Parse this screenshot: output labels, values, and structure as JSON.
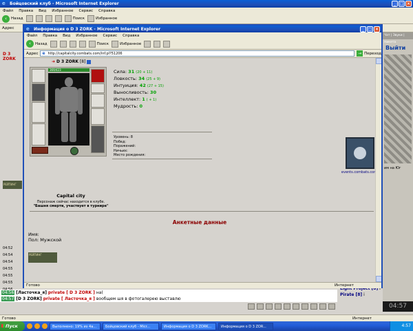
{
  "bg_window": {
    "title": "Бойцовский клуб - Microsoft Internet Explorer",
    "menu": [
      "Файл",
      "Правка",
      "Вид",
      "Избранное",
      "Сервис",
      "Справка"
    ],
    "toolbar": {
      "back": "Назад",
      "search": "Поиск",
      "favorites": "Избранное"
    },
    "address_label": "Адрес",
    "nick": "D 3 ZORK",
    "rating_badge": "РЕЙТИНГ",
    "log_times": [
      "04:52",
      "04:54",
      "04:54",
      "04:55",
      "04:55",
      "04:55",
      "04:56"
    ],
    "right_panel": {
      "tabs": "Чат | Звуки | Никета",
      "exit": "Выйти",
      "map_caption": "им на Юг"
    },
    "status": "Готово",
    "status_zone": "Интернет"
  },
  "chat": {
    "lines": [
      {
        "time": "04:56",
        "nick": "[Ласточка_я]",
        "private": "private [ D 3 ZORK ]",
        "text": "на("
      },
      {
        "time": "04:57",
        "nick": "[D 3 ZORK]",
        "private": "private [ Ласточка_я ]",
        "text": "вообщем шя в фотогалерею выставлю"
      }
    ]
  },
  "online": [
    {
      "name": "Light Project [8]",
      "tag": "i"
    },
    {
      "name": "Pirate [8]",
      "tag": "i"
    }
  ],
  "clock_display": "04:57",
  "fg_window": {
    "title": "Информация о D 3 ZORK - Microsoft Internet Explorer",
    "menu": [
      "Файл",
      "Правка",
      "Вид",
      "Избранное",
      "Сервис",
      "Справка"
    ],
    "toolbar": {
      "back": "Назад",
      "search": "Поиск",
      "favorites": "Избранное"
    },
    "address_label": "Адрес",
    "url": "http://capitalcity.combats.com/inf.pl?51206",
    "go": "Переход",
    "status": "Готово",
    "status_zone": "Интернет"
  },
  "character": {
    "name": "D 3 ZORK",
    "level": "[8]",
    "hp": "369/423",
    "stats": [
      {
        "label": "Сила:",
        "value": "31",
        "bonus": "(20 + 11)"
      },
      {
        "label": "Ловкость:",
        "value": "34",
        "bonus": "(25 + 9)"
      },
      {
        "label": "Интуиция:",
        "value": "42",
        "bonus": "(27 + 15)"
      },
      {
        "label": "Выносливость:",
        "value": "30",
        "bonus": ""
      },
      {
        "label": "Интеллект:",
        "value": "1",
        "bonus": "( + 1)"
      },
      {
        "label": "Мудрость:",
        "value": "0",
        "bonus": ""
      }
    ],
    "meta": [
      "Уровень: 8",
      "Побед:",
      "Поражений:",
      "Ничьих:",
      "Место рождения:"
    ],
    "city": "Capital city",
    "presence": "Персонаж сейчас находится в клубе.",
    "tower": "\"Башня смерти, участвует в турнире\"",
    "emblem_caption": "events.combats.com",
    "rating_badge": "РЕЙТИНГ"
  },
  "anketa": {
    "title": "Анкетные данные",
    "name_label": "Имя:",
    "gender": "Пол: Мужской"
  },
  "taskbar": {
    "start": "Пуск",
    "tasks": [
      "Выполнено: 19% из 4а...",
      "Бойцовский клуб - Micr...",
      "Информация о D 3 ZORK...",
      "Информация о D 3 ZOR..."
    ],
    "time": "4:57"
  }
}
